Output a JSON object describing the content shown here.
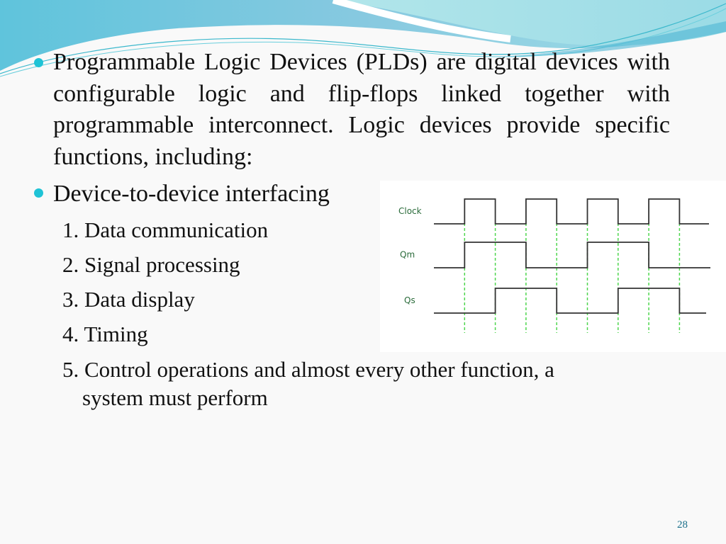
{
  "slide": {
    "bullets": [
      {
        "text": "Programmable Logic Devices (PLDs) are digital devices with configurable logic and flip-flops linked together with programmable interconnect. Logic devices provide specific functions, including:"
      },
      {
        "text": "Device-to-device interfacing"
      }
    ],
    "sub_items": [
      "1. Data communication",
      "2. Signal processing",
      "3. Data display",
      "4. Timing",
      "5. Control operations   and almost every other function, a",
      "system must perform"
    ],
    "page_number": "28",
    "bullet_color": "#1fc3d6"
  },
  "timing_diagram": {
    "signals": [
      {
        "name": "Clock",
        "transitions": [
          0,
          1,
          0,
          1,
          0,
          1,
          0,
          1,
          0
        ],
        "levels": [
          0,
          1,
          0,
          1,
          0,
          1,
          0,
          1,
          0
        ]
      },
      {
        "name": "Qm",
        "levels": [
          0,
          1,
          1,
          0,
          0,
          1,
          1,
          0,
          0
        ]
      },
      {
        "name": "Qs",
        "levels": [
          0,
          0,
          1,
          1,
          0,
          0,
          1,
          1,
          0
        ]
      }
    ],
    "edge_count": 8,
    "label_color": "#2a6b3a",
    "wave_color": "#333333",
    "guide_color": "#4fd64f"
  }
}
